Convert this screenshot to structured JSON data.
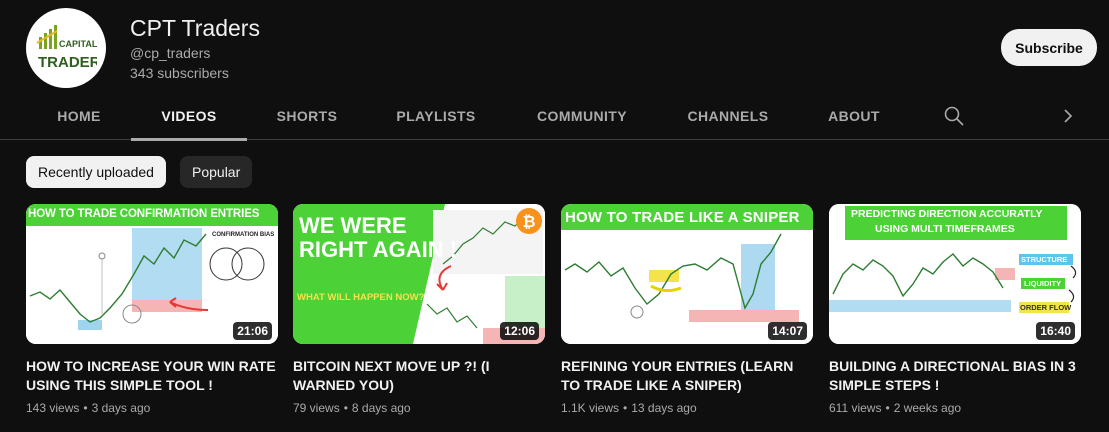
{
  "channel": {
    "name": "CPT Traders",
    "handle": "@cp_traders",
    "subscribers": "343 subscribers",
    "logo_text_top": "CAPITAL",
    "logo_text_bottom": "TRADERS",
    "subscribe_label": "Subscribe"
  },
  "tabs": [
    {
      "label": "HOME",
      "active": false
    },
    {
      "label": "VIDEOS",
      "active": true
    },
    {
      "label": "SHORTS",
      "active": false
    },
    {
      "label": "PLAYLISTS",
      "active": false
    },
    {
      "label": "COMMUNITY",
      "active": false
    },
    {
      "label": "CHANNELS",
      "active": false
    },
    {
      "label": "ABOUT",
      "active": false
    }
  ],
  "icons": {
    "search": "search-icon",
    "next": "chevron-right-icon"
  },
  "chips": [
    {
      "label": "Recently uploaded",
      "selected": true
    },
    {
      "label": "Popular",
      "selected": false
    }
  ],
  "videos": [
    {
      "thumb_lines": [
        "HOW TO TRADE CONFIRMATION ENTRIES",
        "CONFIRMATION BIAS"
      ],
      "duration": "21:06",
      "title": "HOW TO INCREASE YOUR WIN RATE USING THIS SIMPLE TOOL !",
      "views": "143 views",
      "age": "3 days ago"
    },
    {
      "thumb_lines": [
        "WE WERE",
        "RIGHT AGAIN !",
        "WHAT WILL HAPPEN NOW?"
      ],
      "duration": "12:06",
      "title": "BITCOIN NEXT MOVE UP ?! (I WARNED YOU)",
      "views": "79 views",
      "age": "8 days ago"
    },
    {
      "thumb_lines": [
        "HOW TO TRADE LIKE A SNIPER"
      ],
      "duration": "14:07",
      "title": "REFINING YOUR ENTRIES (LEARN TO TRADE LIKE A SNIPER)",
      "views": "1.1K views",
      "age": "13 days ago"
    },
    {
      "thumb_lines": [
        "PREDICTING DIRECTION ACCURATLY",
        "USING MULTI TIMEFRAMES",
        "STRUCTURE",
        "LIQUIDITY",
        "ORDER FLOW"
      ],
      "duration": "16:40",
      "title": "BUILDING A DIRECTIONAL BIAS IN 3 SIMPLE STEPS !",
      "views": "611 views",
      "age": "2 weeks ago"
    }
  ],
  "colors": {
    "background": "#0f0f0f",
    "accent_green": "#4cd137",
    "bitcoin_orange": "#f7931a",
    "highlight_blue": "#9fd3ee",
    "highlight_red": "#f5b5b5"
  }
}
